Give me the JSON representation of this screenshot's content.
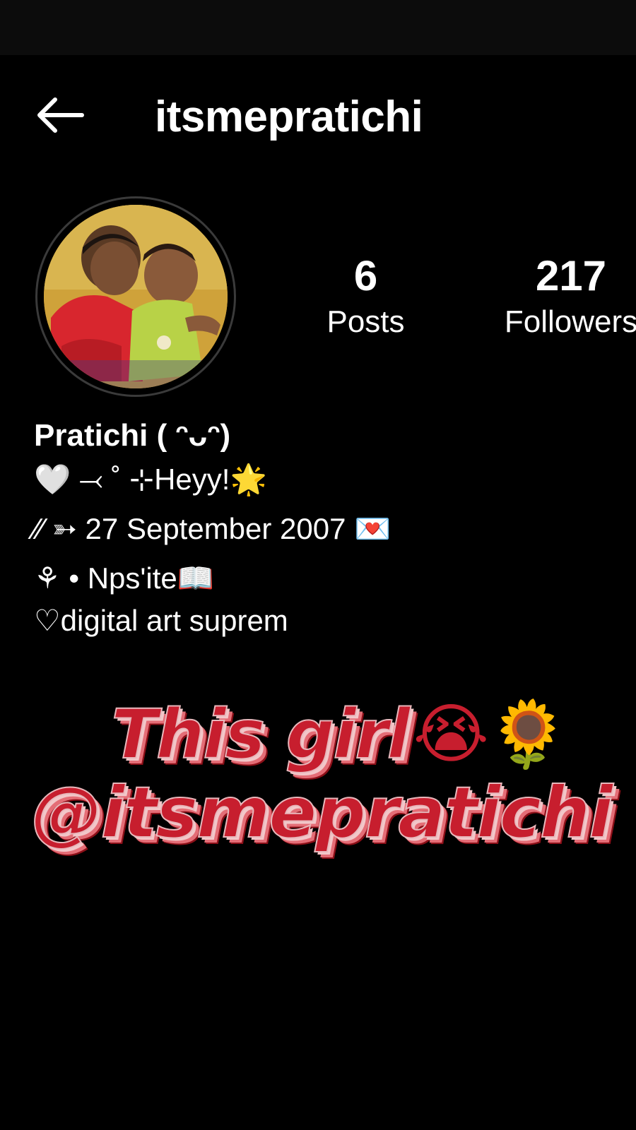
{
  "header": {
    "username": "itsmepratichi"
  },
  "stats": {
    "posts_count": "6",
    "posts_label": "Posts",
    "followers_count": "217",
    "followers_label": "Followers"
  },
  "bio": {
    "name": "Pratichi ( ᵔᴗᵔ)",
    "line1": "🤍 ⤙ ˚ ⊹Heyy!🌟",
    "line2": "⁄⁄ ➳ 27 September 2007 💌",
    "line3": "⚘ • Nps'ite📖",
    "line4": "♡digital art suprem"
  },
  "sticker": {
    "line1": "This girl",
    "line1_emojis": "😭🌻",
    "line2": "@itsmepratichi"
  },
  "icons": {
    "back": "arrow-left-icon"
  },
  "colors": {
    "background": "#000000",
    "sticker_red": "#c71e2e"
  }
}
